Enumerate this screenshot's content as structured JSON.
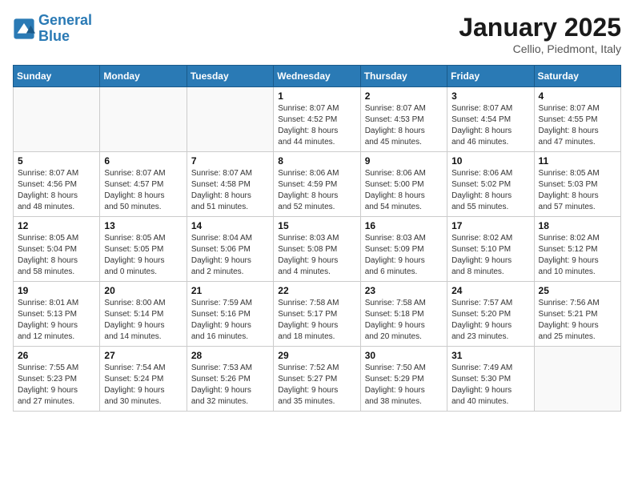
{
  "logo": {
    "line1": "General",
    "line2": "Blue"
  },
  "title": "January 2025",
  "location": "Cellio, Piedmont, Italy",
  "weekdays": [
    "Sunday",
    "Monday",
    "Tuesday",
    "Wednesday",
    "Thursday",
    "Friday",
    "Saturday"
  ],
  "weeks": [
    [
      {
        "day": "",
        "info": ""
      },
      {
        "day": "",
        "info": ""
      },
      {
        "day": "",
        "info": ""
      },
      {
        "day": "1",
        "info": "Sunrise: 8:07 AM\nSunset: 4:52 PM\nDaylight: 8 hours\nand 44 minutes."
      },
      {
        "day": "2",
        "info": "Sunrise: 8:07 AM\nSunset: 4:53 PM\nDaylight: 8 hours\nand 45 minutes."
      },
      {
        "day": "3",
        "info": "Sunrise: 8:07 AM\nSunset: 4:54 PM\nDaylight: 8 hours\nand 46 minutes."
      },
      {
        "day": "4",
        "info": "Sunrise: 8:07 AM\nSunset: 4:55 PM\nDaylight: 8 hours\nand 47 minutes."
      }
    ],
    [
      {
        "day": "5",
        "info": "Sunrise: 8:07 AM\nSunset: 4:56 PM\nDaylight: 8 hours\nand 48 minutes."
      },
      {
        "day": "6",
        "info": "Sunrise: 8:07 AM\nSunset: 4:57 PM\nDaylight: 8 hours\nand 50 minutes."
      },
      {
        "day": "7",
        "info": "Sunrise: 8:07 AM\nSunset: 4:58 PM\nDaylight: 8 hours\nand 51 minutes."
      },
      {
        "day": "8",
        "info": "Sunrise: 8:06 AM\nSunset: 4:59 PM\nDaylight: 8 hours\nand 52 minutes."
      },
      {
        "day": "9",
        "info": "Sunrise: 8:06 AM\nSunset: 5:00 PM\nDaylight: 8 hours\nand 54 minutes."
      },
      {
        "day": "10",
        "info": "Sunrise: 8:06 AM\nSunset: 5:02 PM\nDaylight: 8 hours\nand 55 minutes."
      },
      {
        "day": "11",
        "info": "Sunrise: 8:05 AM\nSunset: 5:03 PM\nDaylight: 8 hours\nand 57 minutes."
      }
    ],
    [
      {
        "day": "12",
        "info": "Sunrise: 8:05 AM\nSunset: 5:04 PM\nDaylight: 8 hours\nand 58 minutes."
      },
      {
        "day": "13",
        "info": "Sunrise: 8:05 AM\nSunset: 5:05 PM\nDaylight: 9 hours\nand 0 minutes."
      },
      {
        "day": "14",
        "info": "Sunrise: 8:04 AM\nSunset: 5:06 PM\nDaylight: 9 hours\nand 2 minutes."
      },
      {
        "day": "15",
        "info": "Sunrise: 8:03 AM\nSunset: 5:08 PM\nDaylight: 9 hours\nand 4 minutes."
      },
      {
        "day": "16",
        "info": "Sunrise: 8:03 AM\nSunset: 5:09 PM\nDaylight: 9 hours\nand 6 minutes."
      },
      {
        "day": "17",
        "info": "Sunrise: 8:02 AM\nSunset: 5:10 PM\nDaylight: 9 hours\nand 8 minutes."
      },
      {
        "day": "18",
        "info": "Sunrise: 8:02 AM\nSunset: 5:12 PM\nDaylight: 9 hours\nand 10 minutes."
      }
    ],
    [
      {
        "day": "19",
        "info": "Sunrise: 8:01 AM\nSunset: 5:13 PM\nDaylight: 9 hours\nand 12 minutes."
      },
      {
        "day": "20",
        "info": "Sunrise: 8:00 AM\nSunset: 5:14 PM\nDaylight: 9 hours\nand 14 minutes."
      },
      {
        "day": "21",
        "info": "Sunrise: 7:59 AM\nSunset: 5:16 PM\nDaylight: 9 hours\nand 16 minutes."
      },
      {
        "day": "22",
        "info": "Sunrise: 7:58 AM\nSunset: 5:17 PM\nDaylight: 9 hours\nand 18 minutes."
      },
      {
        "day": "23",
        "info": "Sunrise: 7:58 AM\nSunset: 5:18 PM\nDaylight: 9 hours\nand 20 minutes."
      },
      {
        "day": "24",
        "info": "Sunrise: 7:57 AM\nSunset: 5:20 PM\nDaylight: 9 hours\nand 23 minutes."
      },
      {
        "day": "25",
        "info": "Sunrise: 7:56 AM\nSunset: 5:21 PM\nDaylight: 9 hours\nand 25 minutes."
      }
    ],
    [
      {
        "day": "26",
        "info": "Sunrise: 7:55 AM\nSunset: 5:23 PM\nDaylight: 9 hours\nand 27 minutes."
      },
      {
        "day": "27",
        "info": "Sunrise: 7:54 AM\nSunset: 5:24 PM\nDaylight: 9 hours\nand 30 minutes."
      },
      {
        "day": "28",
        "info": "Sunrise: 7:53 AM\nSunset: 5:26 PM\nDaylight: 9 hours\nand 32 minutes."
      },
      {
        "day": "29",
        "info": "Sunrise: 7:52 AM\nSunset: 5:27 PM\nDaylight: 9 hours\nand 35 minutes."
      },
      {
        "day": "30",
        "info": "Sunrise: 7:50 AM\nSunset: 5:29 PM\nDaylight: 9 hours\nand 38 minutes."
      },
      {
        "day": "31",
        "info": "Sunrise: 7:49 AM\nSunset: 5:30 PM\nDaylight: 9 hours\nand 40 minutes."
      },
      {
        "day": "",
        "info": ""
      }
    ]
  ]
}
